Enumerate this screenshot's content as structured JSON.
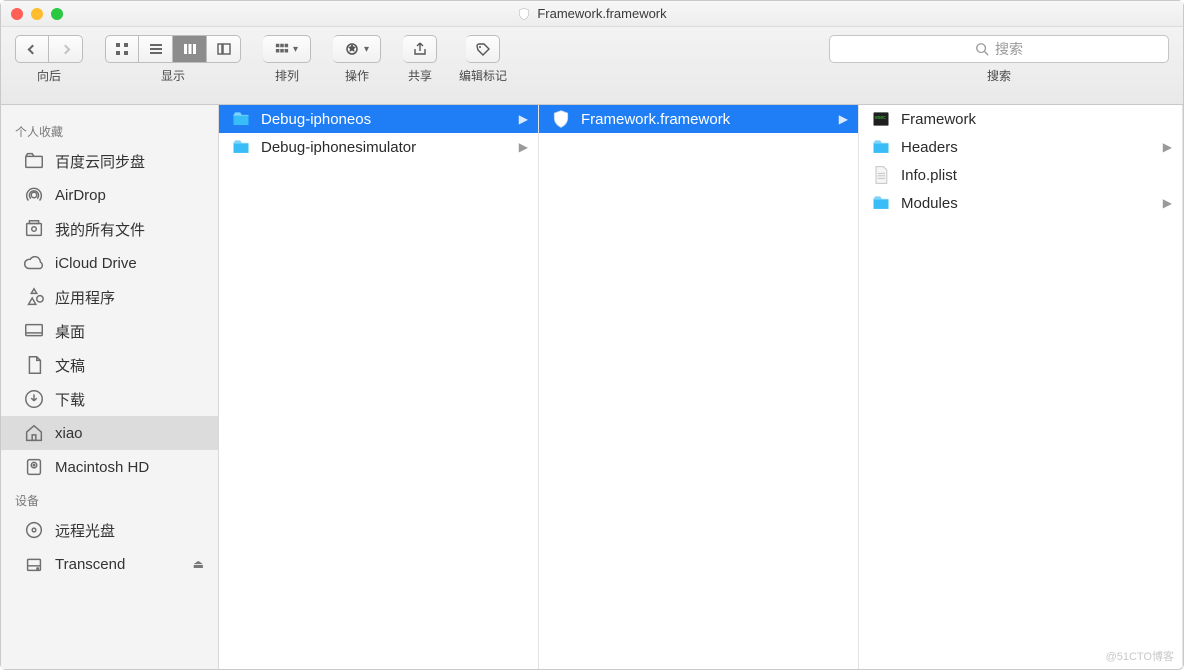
{
  "window": {
    "title": "Framework.framework"
  },
  "toolbar": {
    "nav_label": "向后",
    "view_label": "显示",
    "sort_label": "排列",
    "action_label": "操作",
    "share_label": "共享",
    "tags_label": "编辑标记",
    "search_label": "搜索",
    "search_placeholder": "搜索"
  },
  "sidebar": {
    "sections": [
      {
        "title": "个人收藏",
        "items": [
          {
            "icon": "folder",
            "label": "百度云同步盘"
          },
          {
            "icon": "airdrop",
            "label": "AirDrop"
          },
          {
            "icon": "allfiles",
            "label": "我的所有文件"
          },
          {
            "icon": "cloud",
            "label": "iCloud Drive"
          },
          {
            "icon": "apps",
            "label": "应用程序"
          },
          {
            "icon": "desktop",
            "label": "桌面"
          },
          {
            "icon": "documents",
            "label": "文稿"
          },
          {
            "icon": "downloads",
            "label": "下载"
          },
          {
            "icon": "home",
            "label": "xiao",
            "selected": true
          },
          {
            "icon": "disk",
            "label": "Macintosh HD"
          }
        ]
      },
      {
        "title": "设备",
        "items": [
          {
            "icon": "remotedisc",
            "label": "远程光盘"
          },
          {
            "icon": "ext-drive",
            "label": "Transcend",
            "eject": true
          }
        ]
      }
    ]
  },
  "columns": {
    "col1": [
      {
        "icon": "folder-blue",
        "label": "Debug-iphoneos",
        "selected": true,
        "hasChildren": true
      },
      {
        "icon": "folder-blue",
        "label": "Debug-iphonesimulator",
        "hasChildren": true
      }
    ],
    "col2": [
      {
        "icon": "framework",
        "label": "Framework.framework",
        "selected": true,
        "hasChildren": true
      }
    ],
    "col3": [
      {
        "icon": "exec",
        "label": "Framework"
      },
      {
        "icon": "folder-blue",
        "label": "Headers",
        "hasChildren": true
      },
      {
        "icon": "plist",
        "label": "Info.plist"
      },
      {
        "icon": "folder-blue",
        "label": "Modules",
        "hasChildren": true
      }
    ]
  },
  "watermark": "@51CTO博客"
}
